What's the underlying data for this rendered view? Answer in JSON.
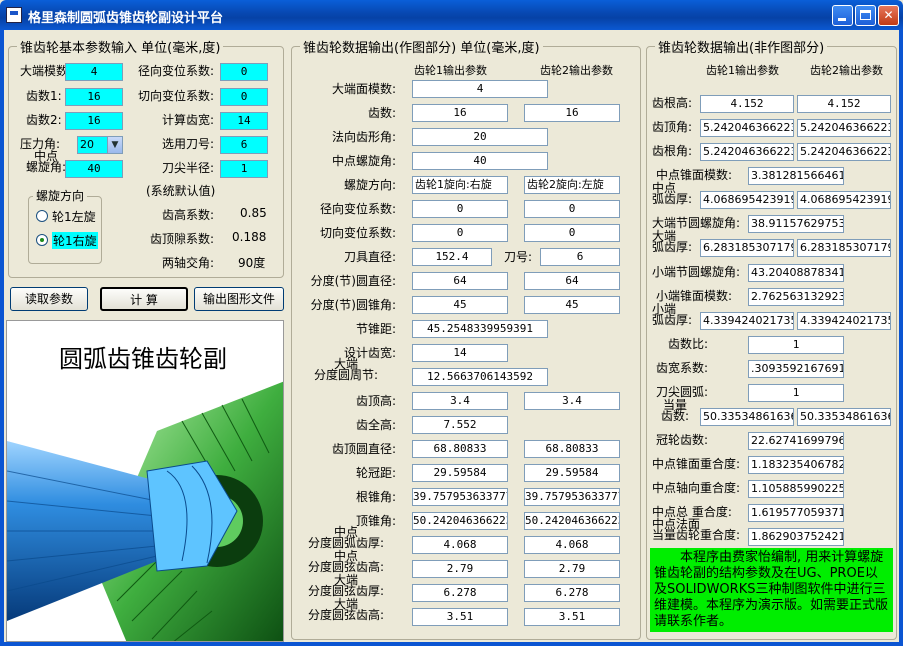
{
  "window": {
    "title": "格里森制圆弧齿锥齿轮副设计平台"
  },
  "input": {
    "legend": "锥齿轮基本参数输入 单位(毫米,度)",
    "module_label": "大端模数:",
    "module": "4",
    "z1_label": "齿数1:",
    "z1": "16",
    "z2_label": "齿数2:",
    "z2": "16",
    "pressure_label": "压力角:",
    "pressure": "20",
    "spiral_label_top": "中点",
    "spiral_label_bottom": "螺旋角:",
    "spiral": "40",
    "radial_shift_label": "径向变位系数:",
    "radial_shift": "0",
    "tangent_shift_label": "切向变位系数:",
    "tangent_shift": "0",
    "face_width_label": "计算齿宽:",
    "face_width": "14",
    "cutter_label": "选用刀号:",
    "cutter": "6",
    "tip_radius_label": "刀尖半径:",
    "tip_radius": "1",
    "direction_legend": "螺旋方向",
    "dir_left": "轮1左旋",
    "dir_right": "轮1右旋",
    "defaults_title": "(系统默认值)",
    "addendum_coef_label": "齿高系数:",
    "addendum_coef": "0.85",
    "clearance_coef_label": "齿顶隙系数:",
    "clearance_coef": "0.188",
    "shaft_angle_label": "两轴交角:",
    "shaft_angle": "90度"
  },
  "buttons": {
    "read": "读取参数",
    "compute": "计 算",
    "export": "输出图形文件"
  },
  "scene": {
    "title": "圆弧齿锥齿轮副"
  },
  "middle": {
    "legend": "锥齿轮数据输出(作图部分) 单位(毫米,度)",
    "col1": "齿轮1输出参数",
    "col2": "齿轮2输出参数",
    "rows": {
      "face_module": {
        "label": "大端面模数:",
        "v": "4"
      },
      "teeth": {
        "label": "齿数:",
        "v1": "16",
        "v2": "16"
      },
      "normal_pressure": {
        "label": "法向齿形角:",
        "v": "20"
      },
      "mid_spiral": {
        "label": "中点螺旋角:",
        "v": "40"
      },
      "spiral_dir": {
        "label": "螺旋方向:",
        "v1": "齿轮1旋向:右旋",
        "v2": "齿轮2旋向:左旋"
      },
      "radial_shift": {
        "label": "径向变位系数:",
        "v1": "0",
        "v2": "0"
      },
      "tangent_shift": {
        "label": "切向变位系数:",
        "v1": "0",
        "v2": "0"
      },
      "cutter_dia": {
        "label": "刀具直径:",
        "v": "152.4",
        "cutter_no_label": "刀号:",
        "cutter_no": "6"
      },
      "pitch_dia": {
        "label": "分度(节)圆直径:",
        "v1": "64",
        "v2": "64"
      },
      "pitch_angle": {
        "label": "分度(节)圆锥角:",
        "v1": "45",
        "v2": "45"
      },
      "cone_distance": {
        "label": "节锥距:",
        "v": "45.2548339959391"
      },
      "design_width": {
        "label": "设计齿宽:",
        "v": "14"
      },
      "circ_pitch": {
        "label_top": "大端",
        "label": "分度圆周节:",
        "v": "12.5663706143592"
      },
      "addendum": {
        "label": "齿顶高:",
        "v1": "3.4",
        "v2": "3.4"
      },
      "whole_depth": {
        "label": "齿全高:",
        "v": "7.552"
      },
      "tip_dia": {
        "label": "齿顶圆直径:",
        "v1": "68.80833",
        "v2": "68.80833"
      },
      "crown_dist": {
        "label": "轮冠距:",
        "v1": "29.59584",
        "v2": "29.59584"
      },
      "root_angle": {
        "label": "根锥角:",
        "v1": "39.757953633777",
        "v2": "39.757953633777"
      },
      "face_angle": {
        "label": "顶锥角:",
        "v1": "50.242046366223",
        "v2": "50.242046366223"
      },
      "mid_arc_thick": {
        "label_top": "中点",
        "label": "分度圆弧齿厚:",
        "v1": "4.068",
        "v2": "4.068"
      },
      "mid_chord_height": {
        "label_top": "中点",
        "label": "分度圆弦齿高:",
        "v1": "2.79",
        "v2": "2.79"
      },
      "outer_chord_thick": {
        "label_top": "大端",
        "label": "分度圆弦齿厚:",
        "v1": "6.278",
        "v2": "6.278"
      },
      "outer_chord_height": {
        "label_top": "大端",
        "label": "分度圆弦齿高:",
        "v1": "3.51",
        "v2": "3.51"
      }
    }
  },
  "right": {
    "legend": "锥齿轮数据输出(非作图部分)",
    "col1": "齿轮1输出参数",
    "col2": "齿轮2输出参数",
    "dedendum": {
      "label": "齿根高:",
      "v1": "4.152",
      "v2": "4.152"
    },
    "addendum_angle": {
      "label": "齿顶角:",
      "v1": "5.2420463662230",
      "v2": "5.2420463662230"
    },
    "dedendum_angle": {
      "label": "齿根角:",
      "v1": "5.2420463662230",
      "v2": "5.2420463662230"
    },
    "mid_module": {
      "label": "中点锥面模数:",
      "v": "3.3812815664617"
    },
    "mid_arc": {
      "label_top": "中点",
      "label": "弧齿厚:",
      "v1": "4.0686954239195",
      "v2": "4.0686954239195"
    },
    "outer_spiral": {
      "label": "大端节圆螺旋角:",
      "v": "38.9115762975319"
    },
    "outer_arc": {
      "label_top": "大端",
      "label": "弧齿厚:",
      "v1": "6.2831853071795",
      "v2": "6.2831853071795"
    },
    "inner_spiral": {
      "label": "小端节圆螺旋角:",
      "v": "43.204088783416"
    },
    "inner_module": {
      "label": "小端锥面模数:",
      "v": "2.7625631329235"
    },
    "inner_arc": {
      "label_top": "小端",
      "label": "弧齿厚:",
      "v1": "4.3394240217353",
      "v2": "4.3394240217353"
    },
    "ratio": {
      "label": "齿数比:",
      "v": "1"
    },
    "width_coef": {
      "label": "齿宽系数:",
      "v": ".30935921676911"
    },
    "tip_arc": {
      "label": "刀尖圆弧:",
      "v": "1"
    },
    "virtual_teeth": {
      "label_top": "当量",
      "label": "齿数:",
      "v1": "50.335348616360",
      "v2": "50.335348616360"
    },
    "crown_teeth": {
      "label": "冠轮齿数:",
      "v": "22.627416997969"
    },
    "mid_face_contact": {
      "label": "中点锥面重合度:",
      "v": "1.1832354067828"
    },
    "mid_axial_contact": {
      "label": "中点轴向重合度:",
      "v": "1.1058859902251"
    },
    "mid_total_contact": {
      "label": "中点总 重合度:",
      "v": "1.6195770593710"
    },
    "mid_normal_contact": {
      "label_top": "中点法面",
      "label": "当量齿轮重合度:",
      "v": "1.8629037524212"
    },
    "note": "本程序由费家怡编制, 用来计算螺旋锥齿轮副的结构参数及在UG、PROE以及SOLIDWORKS三种制图软件中进行三维建模。本程序为演示版。如需要正式版请联系作者。"
  }
}
